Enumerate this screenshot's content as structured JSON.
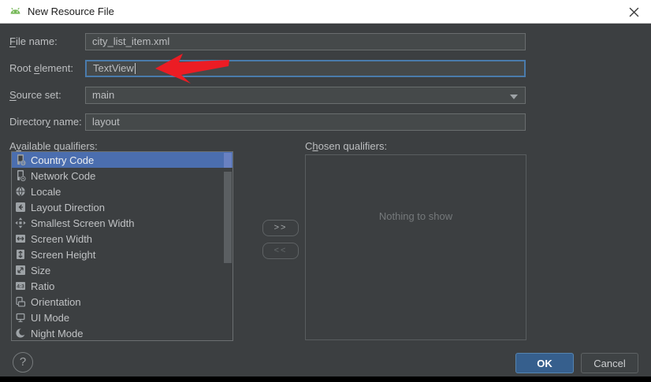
{
  "window": {
    "title": "New Resource File"
  },
  "form": {
    "file_name": {
      "label": {
        "text": "File name:",
        "key": "F"
      },
      "value": "city_list_item.xml"
    },
    "root_element": {
      "label": {
        "text": "Root element:",
        "key": "e"
      },
      "value": "TextView"
    },
    "source_set": {
      "label": {
        "text": "Source set:",
        "key": "S"
      },
      "value": "main"
    },
    "directory_name": {
      "label": {
        "text": "Directory name:",
        "key": "y"
      },
      "value": "layout"
    }
  },
  "qualifiers": {
    "available_label": {
      "text": "Available qualifiers:",
      "key": "v"
    },
    "chosen_label": {
      "text": "Chosen qualifiers:",
      "key": "h"
    },
    "available": [
      {
        "label": "Country Code",
        "icon": "country-code",
        "selected": true
      },
      {
        "label": "Network Code",
        "icon": "network-code",
        "selected": false
      },
      {
        "label": "Locale",
        "icon": "locale",
        "selected": false
      },
      {
        "label": "Layout Direction",
        "icon": "layout-direction",
        "selected": false
      },
      {
        "label": "Smallest Screen Width",
        "icon": "smallest-screen-width",
        "selected": false
      },
      {
        "label": "Screen Width",
        "icon": "screen-width",
        "selected": false
      },
      {
        "label": "Screen Height",
        "icon": "screen-height",
        "selected": false
      },
      {
        "label": "Size",
        "icon": "size",
        "selected": false
      },
      {
        "label": "Ratio",
        "icon": "ratio",
        "selected": false
      },
      {
        "label": "Orientation",
        "icon": "orientation",
        "selected": false
      },
      {
        "label": "UI Mode",
        "icon": "ui-mode",
        "selected": false
      },
      {
        "label": "Night Mode",
        "icon": "night-mode",
        "selected": false
      }
    ],
    "chosen_empty_text": "Nothing to show",
    "add_button": ">>",
    "remove_button": "<<"
  },
  "footer": {
    "help": "?",
    "ok": "OK",
    "cancel": "Cancel"
  },
  "colors": {
    "selection": "#4b6eaf",
    "focus_border": "#4a7bac",
    "ok_background": "#365f8d",
    "annotation_arrow": "#ec1c24"
  }
}
